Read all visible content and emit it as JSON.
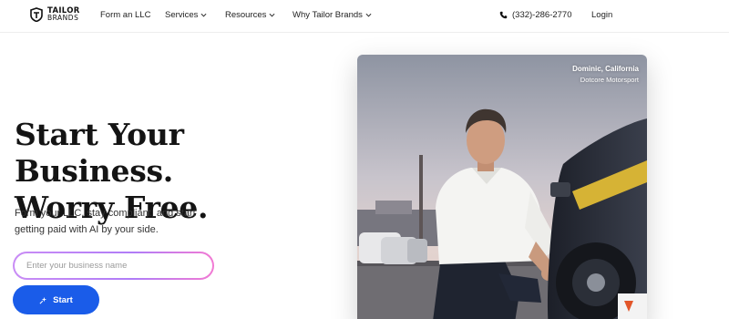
{
  "nav": {
    "logo_line1": "TAILOR",
    "logo_line2": "BRANDS",
    "items": [
      {
        "label": "Form an LLC",
        "has_dropdown": false
      },
      {
        "label": "Services",
        "has_dropdown": true
      },
      {
        "label": "Resources",
        "has_dropdown": true
      },
      {
        "label": "Why Tailor Brands",
        "has_dropdown": true
      }
    ],
    "phone": "(332)-286-2770",
    "login": "Login"
  },
  "hero": {
    "headline_line1": "Start Your Business.",
    "headline_line2": "Worry Free.",
    "subtext": "Form your LLC, stay compliant, and start getting paid with AI by your side.",
    "input_placeholder": "Enter your business name",
    "input_value": "",
    "start_label": "Start"
  },
  "photo": {
    "caption_name": "Dominic, California",
    "caption_company": "Dotcore Motorsport"
  },
  "colors": {
    "primary_button": "#1a5ce9",
    "input_border_start": "#c98cf5",
    "input_border_end": "#f27ad3"
  },
  "icons": [
    "tailor-brands-logo-icon",
    "chevron-down-icon",
    "phone-icon",
    "sparkle-icon"
  ]
}
